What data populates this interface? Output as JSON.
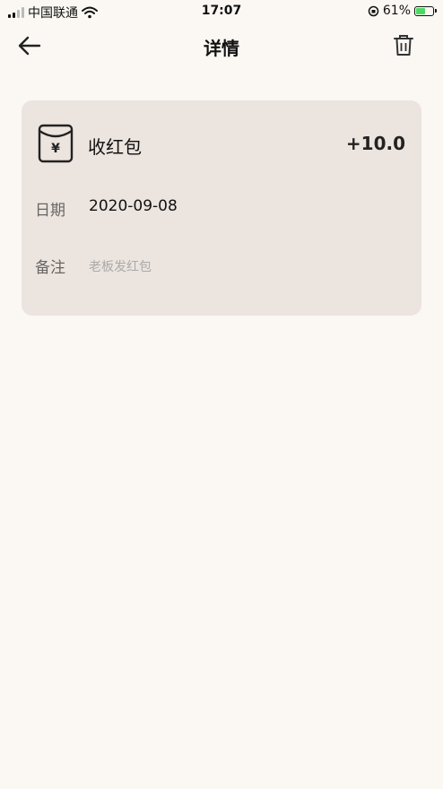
{
  "status_bar": {
    "carrier": "中国联通",
    "time": "17:07",
    "battery_percent": "61%",
    "battery_level": 0.61
  },
  "header": {
    "title": "详情",
    "back_icon": "arrow-left-icon",
    "delete_icon": "trash-icon"
  },
  "record": {
    "icon": "red-envelope-icon",
    "type": "收红包",
    "amount": "+10.0",
    "date_label": "日期",
    "date_value": "2020-09-08",
    "note_label": "备注",
    "note_value": "老板发红包"
  },
  "colors": {
    "background": "#fbf8f3",
    "card": "#ece4de"
  }
}
